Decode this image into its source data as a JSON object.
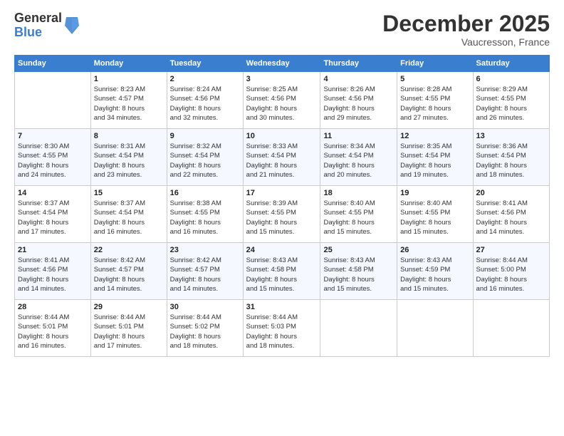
{
  "logo": {
    "general": "General",
    "blue": "Blue"
  },
  "header": {
    "month": "December 2025",
    "location": "Vaucresson, France"
  },
  "weekdays": [
    "Sunday",
    "Monday",
    "Tuesday",
    "Wednesday",
    "Thursday",
    "Friday",
    "Saturday"
  ],
  "weeks": [
    [
      {
        "day": "",
        "detail": ""
      },
      {
        "day": "1",
        "detail": "Sunrise: 8:23 AM\nSunset: 4:57 PM\nDaylight: 8 hours\nand 34 minutes."
      },
      {
        "day": "2",
        "detail": "Sunrise: 8:24 AM\nSunset: 4:56 PM\nDaylight: 8 hours\nand 32 minutes."
      },
      {
        "day": "3",
        "detail": "Sunrise: 8:25 AM\nSunset: 4:56 PM\nDaylight: 8 hours\nand 30 minutes."
      },
      {
        "day": "4",
        "detail": "Sunrise: 8:26 AM\nSunset: 4:56 PM\nDaylight: 8 hours\nand 29 minutes."
      },
      {
        "day": "5",
        "detail": "Sunrise: 8:28 AM\nSunset: 4:55 PM\nDaylight: 8 hours\nand 27 minutes."
      },
      {
        "day": "6",
        "detail": "Sunrise: 8:29 AM\nSunset: 4:55 PM\nDaylight: 8 hours\nand 26 minutes."
      }
    ],
    [
      {
        "day": "7",
        "detail": "Sunrise: 8:30 AM\nSunset: 4:55 PM\nDaylight: 8 hours\nand 24 minutes."
      },
      {
        "day": "8",
        "detail": "Sunrise: 8:31 AM\nSunset: 4:54 PM\nDaylight: 8 hours\nand 23 minutes."
      },
      {
        "day": "9",
        "detail": "Sunrise: 8:32 AM\nSunset: 4:54 PM\nDaylight: 8 hours\nand 22 minutes."
      },
      {
        "day": "10",
        "detail": "Sunrise: 8:33 AM\nSunset: 4:54 PM\nDaylight: 8 hours\nand 21 minutes."
      },
      {
        "day": "11",
        "detail": "Sunrise: 8:34 AM\nSunset: 4:54 PM\nDaylight: 8 hours\nand 20 minutes."
      },
      {
        "day": "12",
        "detail": "Sunrise: 8:35 AM\nSunset: 4:54 PM\nDaylight: 8 hours\nand 19 minutes."
      },
      {
        "day": "13",
        "detail": "Sunrise: 8:36 AM\nSunset: 4:54 PM\nDaylight: 8 hours\nand 18 minutes."
      }
    ],
    [
      {
        "day": "14",
        "detail": "Sunrise: 8:37 AM\nSunset: 4:54 PM\nDaylight: 8 hours\nand 17 minutes."
      },
      {
        "day": "15",
        "detail": "Sunrise: 8:37 AM\nSunset: 4:54 PM\nDaylight: 8 hours\nand 16 minutes."
      },
      {
        "day": "16",
        "detail": "Sunrise: 8:38 AM\nSunset: 4:55 PM\nDaylight: 8 hours\nand 16 minutes."
      },
      {
        "day": "17",
        "detail": "Sunrise: 8:39 AM\nSunset: 4:55 PM\nDaylight: 8 hours\nand 15 minutes."
      },
      {
        "day": "18",
        "detail": "Sunrise: 8:40 AM\nSunset: 4:55 PM\nDaylight: 8 hours\nand 15 minutes."
      },
      {
        "day": "19",
        "detail": "Sunrise: 8:40 AM\nSunset: 4:55 PM\nDaylight: 8 hours\nand 15 minutes."
      },
      {
        "day": "20",
        "detail": "Sunrise: 8:41 AM\nSunset: 4:56 PM\nDaylight: 8 hours\nand 14 minutes."
      }
    ],
    [
      {
        "day": "21",
        "detail": "Sunrise: 8:41 AM\nSunset: 4:56 PM\nDaylight: 8 hours\nand 14 minutes."
      },
      {
        "day": "22",
        "detail": "Sunrise: 8:42 AM\nSunset: 4:57 PM\nDaylight: 8 hours\nand 14 minutes."
      },
      {
        "day": "23",
        "detail": "Sunrise: 8:42 AM\nSunset: 4:57 PM\nDaylight: 8 hours\nand 14 minutes."
      },
      {
        "day": "24",
        "detail": "Sunrise: 8:43 AM\nSunset: 4:58 PM\nDaylight: 8 hours\nand 15 minutes."
      },
      {
        "day": "25",
        "detail": "Sunrise: 8:43 AM\nSunset: 4:58 PM\nDaylight: 8 hours\nand 15 minutes."
      },
      {
        "day": "26",
        "detail": "Sunrise: 8:43 AM\nSunset: 4:59 PM\nDaylight: 8 hours\nand 15 minutes."
      },
      {
        "day": "27",
        "detail": "Sunrise: 8:44 AM\nSunset: 5:00 PM\nDaylight: 8 hours\nand 16 minutes."
      }
    ],
    [
      {
        "day": "28",
        "detail": "Sunrise: 8:44 AM\nSunset: 5:01 PM\nDaylight: 8 hours\nand 16 minutes."
      },
      {
        "day": "29",
        "detail": "Sunrise: 8:44 AM\nSunset: 5:01 PM\nDaylight: 8 hours\nand 17 minutes."
      },
      {
        "day": "30",
        "detail": "Sunrise: 8:44 AM\nSunset: 5:02 PM\nDaylight: 8 hours\nand 18 minutes."
      },
      {
        "day": "31",
        "detail": "Sunrise: 8:44 AM\nSunset: 5:03 PM\nDaylight: 8 hours\nand 18 minutes."
      },
      {
        "day": "",
        "detail": ""
      },
      {
        "day": "",
        "detail": ""
      },
      {
        "day": "",
        "detail": ""
      }
    ]
  ]
}
